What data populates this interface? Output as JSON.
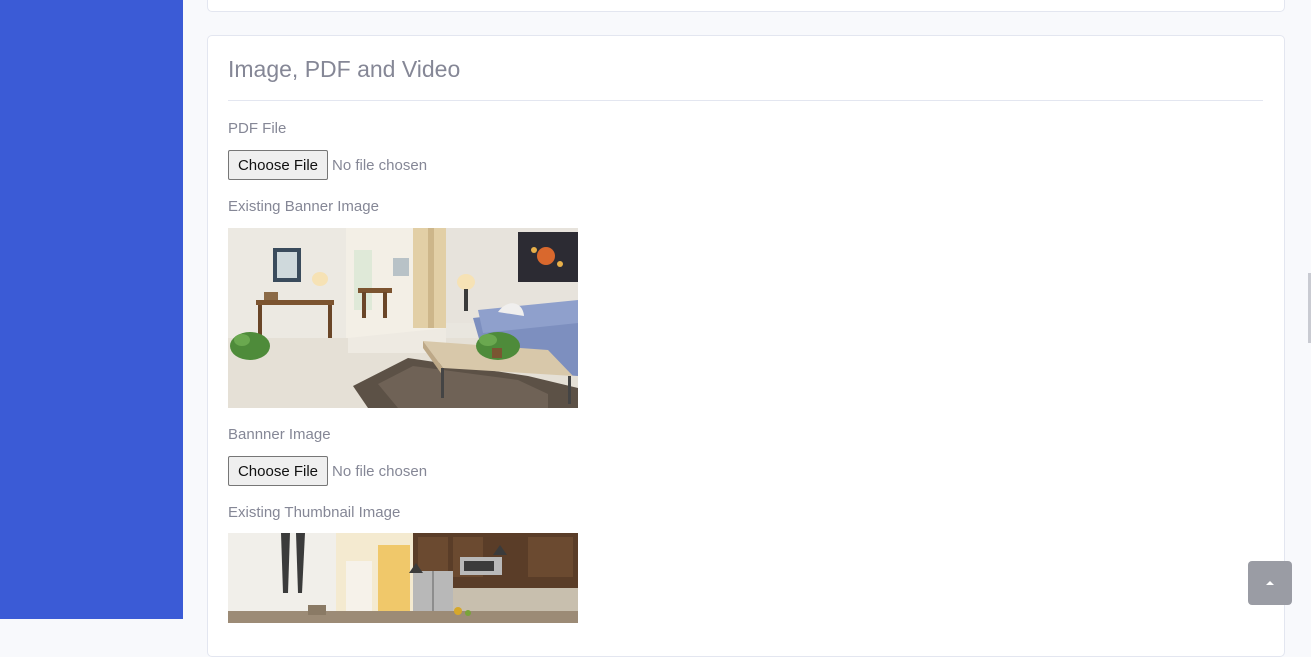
{
  "section": {
    "title": "Image, PDF and Video"
  },
  "pdf": {
    "label": "PDF File",
    "button": "Choose File",
    "status": "No file chosen"
  },
  "existing_banner": {
    "label": "Existing Banner Image"
  },
  "banner": {
    "label": "Bannner Image",
    "button": "Choose File",
    "status": "No file chosen"
  },
  "existing_thumbnail": {
    "label": "Existing Thumbnail Image"
  },
  "colors": {
    "sidebar": "#3b5bd6",
    "page_bg": "#f8f9fc",
    "text_muted": "#858796",
    "scroll_button": "#9a9ca4"
  },
  "icons": {
    "scroll_top": "chevron-up-icon"
  }
}
